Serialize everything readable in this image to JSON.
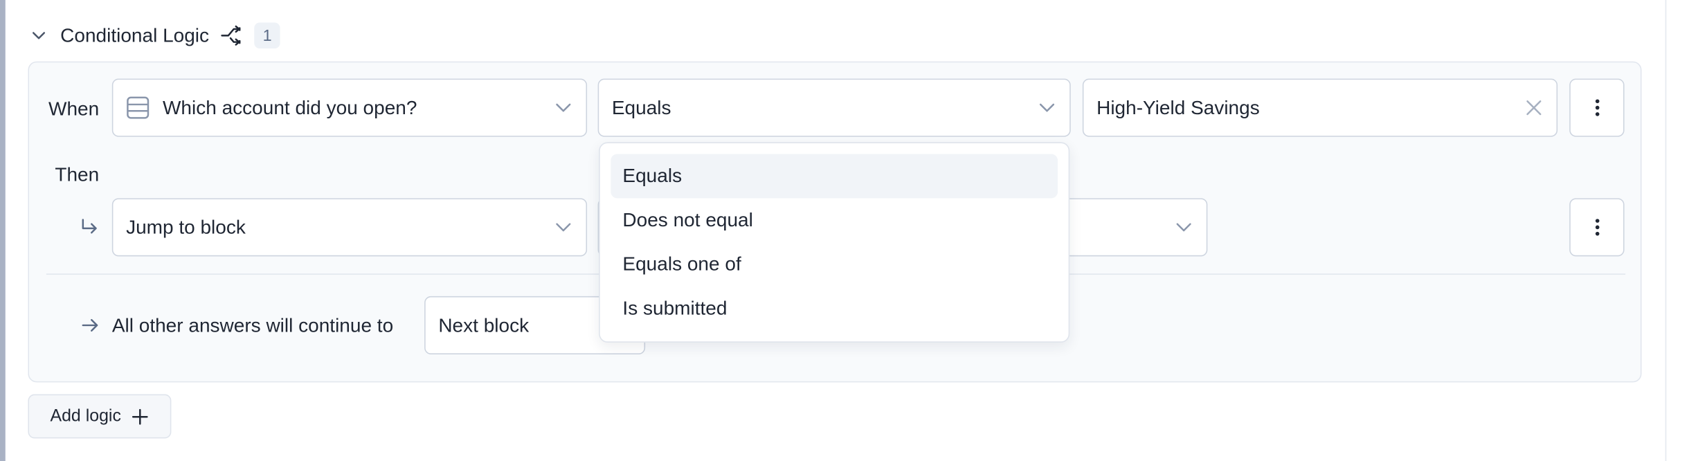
{
  "header": {
    "title": "Conditional Logic",
    "count": "1"
  },
  "rule": {
    "when_label": "When",
    "question_value": "Which account did you open?",
    "operator_value": "Equals",
    "answer_value": "High-Yield Savings",
    "then_label": "Then",
    "action_value": "Jump to block",
    "target_value": "",
    "fallback_label": "All other answers will continue to",
    "fallback_value": "Next block"
  },
  "operator_dropdown": {
    "options": [
      "Equals",
      "Does not equal",
      "Equals one of",
      "Is submitted"
    ],
    "highlighted": "Equals"
  },
  "footer": {
    "add_logic_label": "Add logic"
  },
  "colors": {
    "text": "#1f2633",
    "border": "#cdd4df",
    "panel_bg": "#f8fafc",
    "icon": "#8a96ab"
  },
  "icons": {
    "collapse": "chevron-down-icon",
    "branch": "branch-shuffle-icon",
    "question_type": "list-icon",
    "clear": "close-icon",
    "more": "kebab-icon",
    "then": "arrow-return-icon",
    "fallback": "arrow-right-icon",
    "add": "plus-icon"
  }
}
